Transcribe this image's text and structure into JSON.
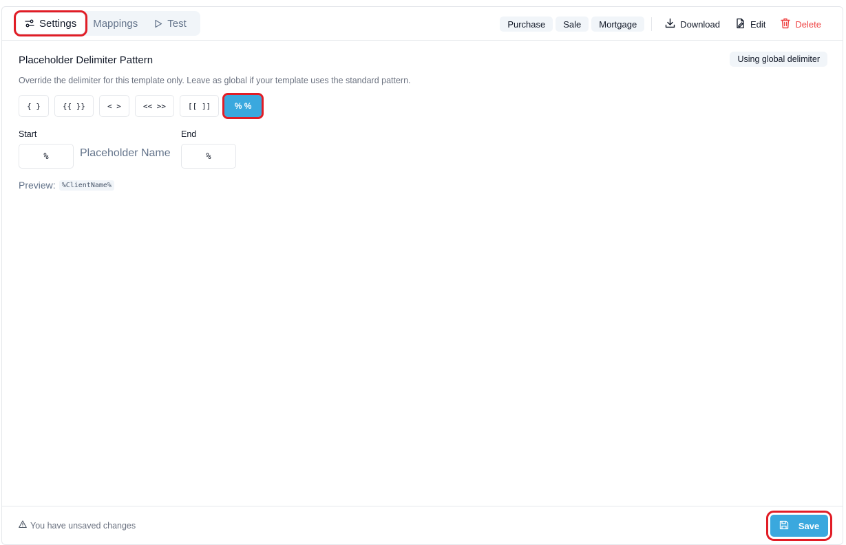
{
  "tabs": [
    {
      "label": "Settings",
      "icon": "settings-sliders-icon",
      "active": true
    },
    {
      "label": "Mappings",
      "icon": "",
      "active": false
    },
    {
      "label": "Test",
      "icon": "play-icon",
      "active": false
    }
  ],
  "toolbar": {
    "chips": [
      "Purchase",
      "Sale",
      "Mortgage"
    ],
    "download_label": "Download",
    "edit_label": "Edit",
    "delete_label": "Delete"
  },
  "delimiter": {
    "title": "Placeholder Delimiter Pattern",
    "badge": "Using global delimiter",
    "description": "Override the delimiter for this template only. Leave as global if your template uses the standard pattern.",
    "options": [
      "{ }",
      "{{ }}",
      "< >",
      "<< >>",
      "[[ ]]",
      "% %"
    ],
    "selected": "% %",
    "start_label": "Start",
    "start_value": "%",
    "end_label": "End",
    "end_value": "%",
    "placeholder_name": "Placeholder Name",
    "preview_label": "Preview:",
    "preview_value": "%ClientName%"
  },
  "footer": {
    "unsaved_text": "You have unsaved changes",
    "save_label": "Save"
  },
  "colors": {
    "accent": "#3aa8de",
    "danger": "#ef4444",
    "highlight": "#e11d26"
  }
}
